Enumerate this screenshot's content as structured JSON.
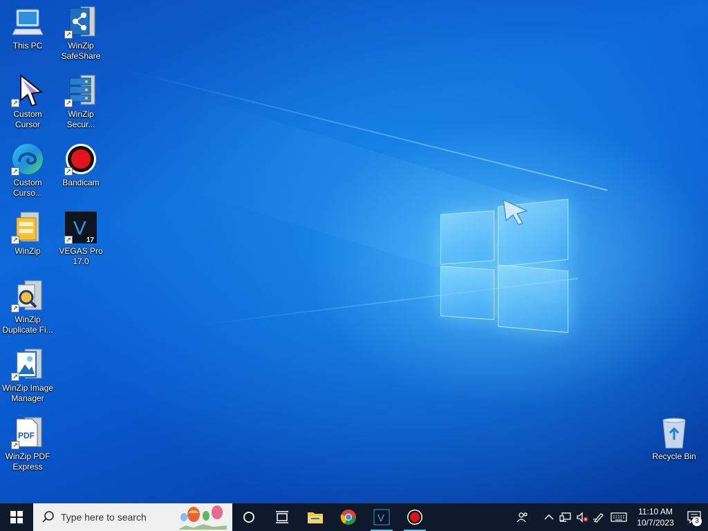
{
  "desktop": {
    "icons": [
      {
        "name": "this-pc",
        "label": "This PC",
        "icon": "computer-icon"
      },
      {
        "name": "winzip-safeshare",
        "label": "WinZip SafeShare",
        "icon": "winzip-safeshare-icon"
      },
      {
        "name": "custom-cursor",
        "label": "Custom Cursor",
        "icon": "cursor-arrow-icon"
      },
      {
        "name": "winzip-secure",
        "label": "WinZip Secur...",
        "icon": "winzip-secure-backup-icon"
      },
      {
        "name": "custom-curso-edge",
        "label": "Custom Curso...",
        "icon": "edge-browser-icon"
      },
      {
        "name": "bandicam",
        "label": "Bandicam",
        "icon": "record-icon"
      },
      {
        "name": "winzip",
        "label": "WinZip",
        "icon": "winzip-icon"
      },
      {
        "name": "vegas-pro",
        "label": "VEGAS Pro 17.0",
        "icon": "vegas-pro-icon"
      },
      {
        "name": "winzip-duplicate-finder",
        "label": "WinZip Duplicate Fi...",
        "icon": "winzip-duplicate-finder-icon"
      },
      {
        "name": "winzip-image-manager",
        "label": "WinZip Image Manager",
        "icon": "winzip-image-manager-icon"
      },
      {
        "name": "winzip-pdf-express",
        "label": "WinZip PDF Express",
        "icon": "winzip-pdf-icon"
      },
      {
        "name": "recycle-bin",
        "label": "Recycle Bin",
        "icon": "recycle-bin-icon"
      }
    ]
  },
  "taskbar": {
    "search_placeholder": "Type here to search",
    "pinned": [
      "cortana-icon",
      "task-view-icon",
      "file-explorer-icon",
      "chrome-icon",
      "vegas-pro-icon",
      "bandicam-icon"
    ],
    "tray": {
      "time": "11:10 AM",
      "date": "10/7/2023",
      "notification_count": "3"
    }
  },
  "colors": {
    "taskbar": "#0e1a2b",
    "accent": "#76b9ed",
    "wallpaper": "#0a5ad0"
  }
}
